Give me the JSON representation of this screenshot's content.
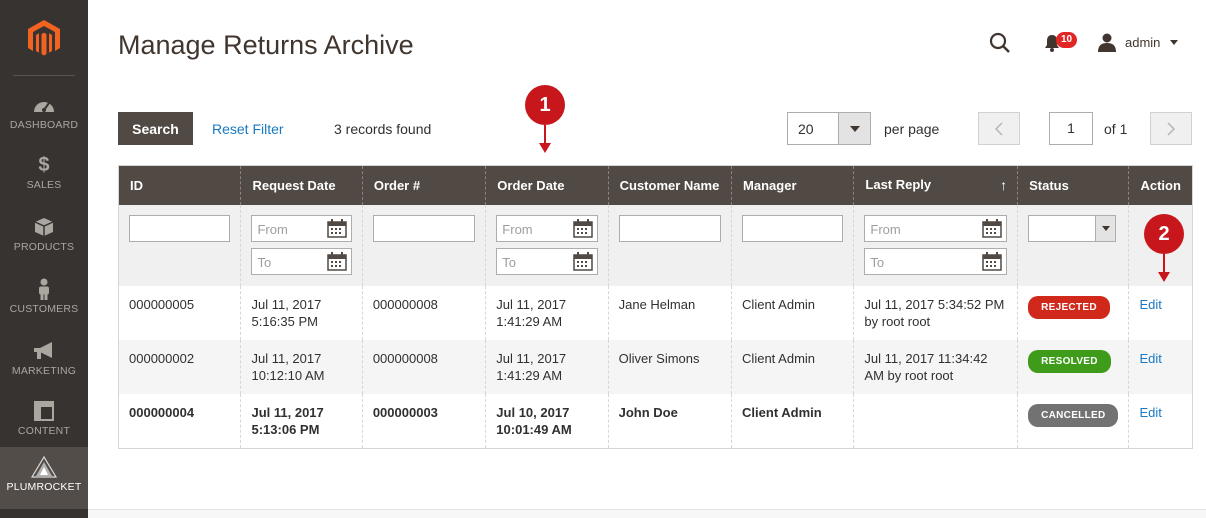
{
  "sidebar": {
    "items": [
      {
        "label": "DASHBOARD",
        "icon": "gauge-icon"
      },
      {
        "label": "SALES",
        "icon": "dollar-icon"
      },
      {
        "label": "PRODUCTS",
        "icon": "box-icon"
      },
      {
        "label": "CUSTOMERS",
        "icon": "person-icon"
      },
      {
        "label": "MARKETING",
        "icon": "megaphone-icon"
      },
      {
        "label": "CONTENT",
        "icon": "layout-icon"
      },
      {
        "label": "PLUMROCKET",
        "icon": "plumrocket-icon"
      }
    ]
  },
  "header": {
    "title": "Manage Returns Archive",
    "notifications_count": "10",
    "user_name": "admin"
  },
  "toolbar": {
    "search_label": "Search",
    "reset_label": "Reset Filter",
    "records_found": "3 records found",
    "per_page_value": "20",
    "per_page_label": "per page",
    "page_current": "1",
    "page_of": "of 1"
  },
  "grid": {
    "columns": [
      "ID",
      "Request Date",
      "Order #",
      "Order Date",
      "Customer Name",
      "Manager",
      "Last Reply",
      "Status",
      "Action"
    ],
    "sort_arrow": "↑",
    "filters": {
      "from_placeholder": "From",
      "to_placeholder": "To"
    },
    "rows": [
      {
        "id": "000000005",
        "request_date_1": "Jul 11, 2017",
        "request_date_2": "5:16:35 PM",
        "order": "000000008",
        "order_date_1": "Jul 11, 2017",
        "order_date_2": "1:41:29 AM",
        "customer": "Jane Helman",
        "manager": "Client Admin",
        "last_reply_1": "Jul 11, 2017 5:34:52 PM",
        "last_reply_2": "by root root",
        "status": "REJECTED",
        "action": "Edit"
      },
      {
        "id": "000000002",
        "request_date_1": "Jul 11, 2017",
        "request_date_2": "10:12:10 AM",
        "order": "000000008",
        "order_date_1": "Jul 11, 2017",
        "order_date_2": "1:41:29 AM",
        "customer": "Oliver Simons",
        "manager": "Client Admin",
        "last_reply_1": "Jul 11, 2017 11:34:42",
        "last_reply_2": "AM by root root",
        "status": "RESOLVED",
        "action": "Edit"
      },
      {
        "id": "000000004",
        "request_date_1": "Jul 11, 2017",
        "request_date_2": "5:13:06 PM",
        "order": "000000003",
        "order_date_1": "Jul 10, 2017",
        "order_date_2": "10:01:49 AM",
        "customer": "John Doe",
        "manager": "Client Admin",
        "last_reply_1": "",
        "last_reply_2": "",
        "status": "CANCELLED",
        "action": "Edit"
      }
    ]
  },
  "colors": {
    "rejected": "#d0291c",
    "resolved": "#3e9c1a",
    "cancelled": "#727272",
    "header_bg": "#514943",
    "link": "#1979c3",
    "callout": "#c7161c"
  },
  "callouts": [
    "1",
    "2"
  ]
}
